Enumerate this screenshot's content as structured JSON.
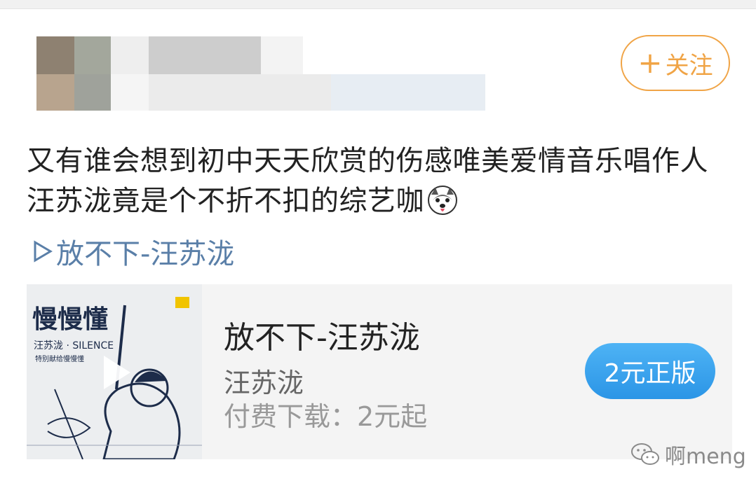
{
  "header": {
    "follow_label": "关注",
    "follow_plus": "+"
  },
  "post": {
    "text": "又有谁会想到初中天天欣赏的伤感唯美爱情音乐唱作人汪苏泷竟是个不折不扣的综艺咖",
    "emoji": "husky-dog-emoji-icon",
    "music_link": "放不下-汪苏泷"
  },
  "card": {
    "title": "放不下-汪苏泷",
    "artist": "汪苏泷",
    "price_text": "付费下载：2元起",
    "buy_label": "2元正版",
    "cover": {
      "title_text": "慢慢懂",
      "subtitle_text": "汪苏泷 · SILENCE",
      "tag_text": "特别献给慢慢懂"
    }
  },
  "watermark": {
    "text": "啊meng"
  },
  "colors": {
    "follow": "#f0a446",
    "link": "#5a7fa8",
    "buy": "#2b95e6"
  }
}
